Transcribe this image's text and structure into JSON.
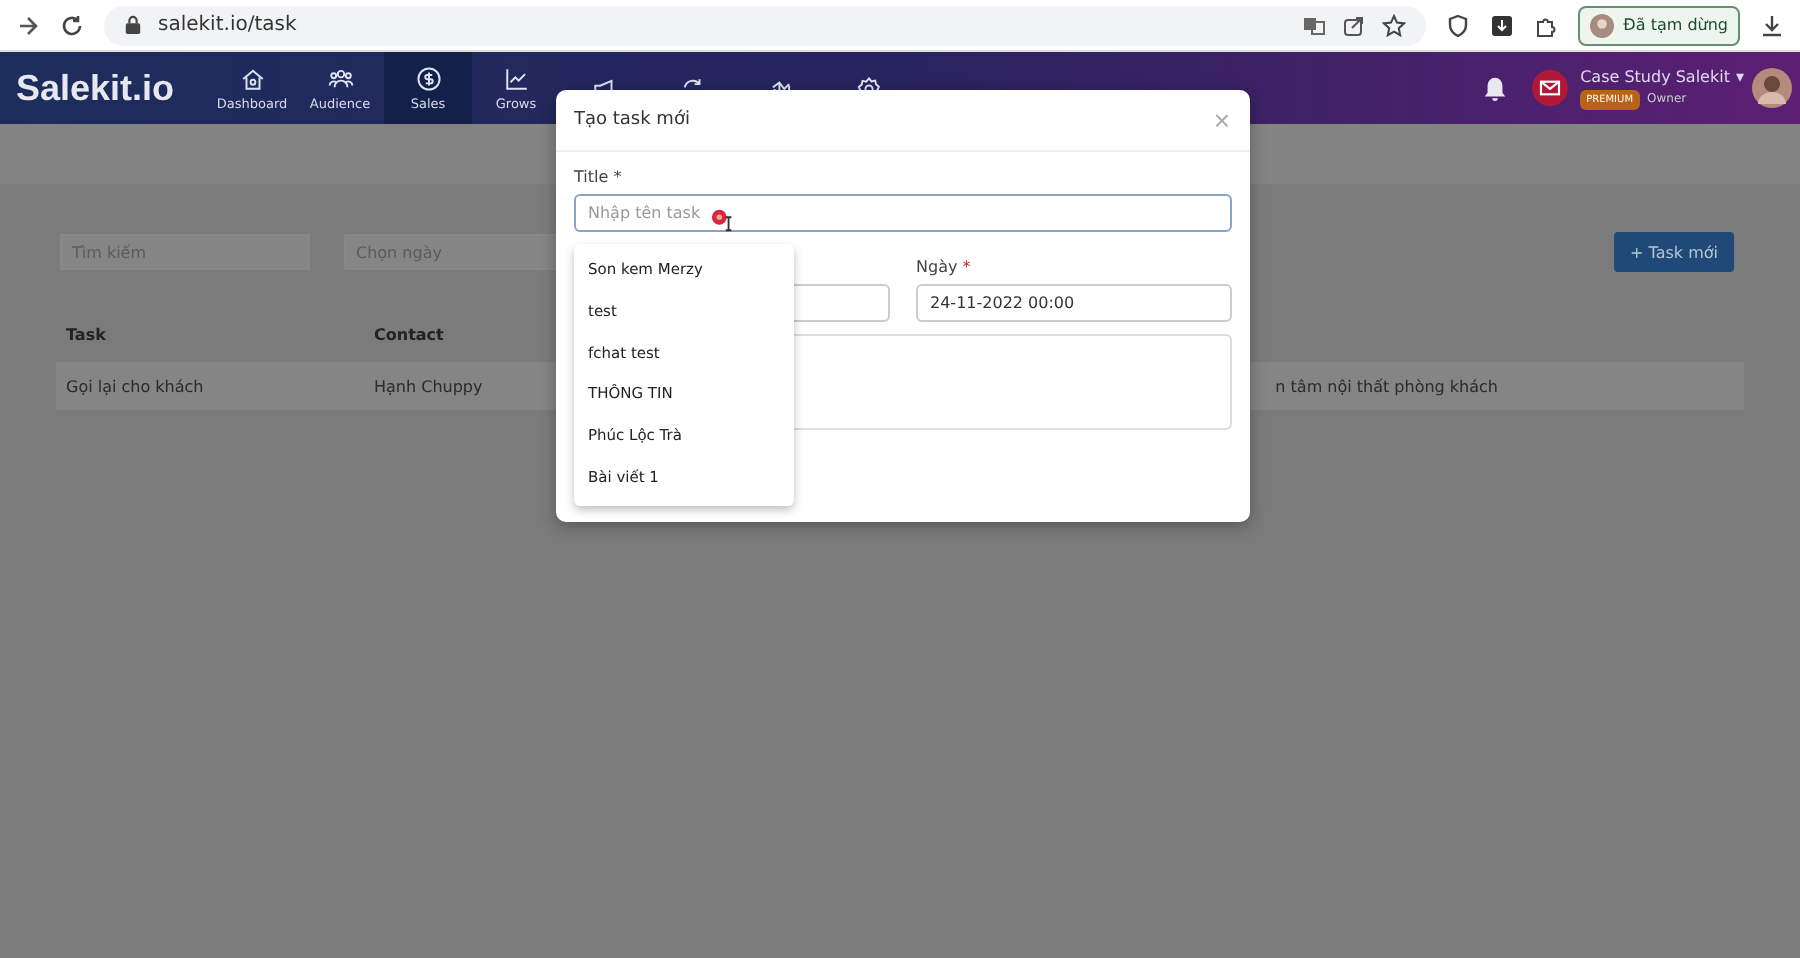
{
  "browser": {
    "url": "salekit.io/task",
    "profile_button": "Đã tạm dừng"
  },
  "nav": {
    "logo": "Salekit.io",
    "items": [
      {
        "label": "Dashboard",
        "kind": "home",
        "selected": false
      },
      {
        "label": "Audience",
        "kind": "people",
        "selected": false
      },
      {
        "label": "Sales",
        "kind": "dollar",
        "selected": true
      },
      {
        "label": "Grows",
        "kind": "trend",
        "selected": false
      },
      {
        "kind": "megaphone",
        "selected": false
      },
      {
        "kind": "sync",
        "selected": false
      },
      {
        "kind": "bars",
        "selected": false
      },
      {
        "kind": "gear",
        "selected": false
      }
    ],
    "account": {
      "name": "Case Study Salekit",
      "caret": "▾",
      "badge": "PREMIUM",
      "role": "Owner"
    }
  },
  "filters": {
    "search_placeholder": "Tìm kiếm",
    "date_placeholder": "Chọn ngày"
  },
  "new_task_button": "+ Task mới",
  "table": {
    "columns": [
      "Task",
      "Contact"
    ],
    "rows": [
      {
        "cells": [
          "Gọi lại cho khách",
          "Hạnh Chuppy"
        ],
        "column_last": "n tâm nội thất phòng khách"
      }
    ]
  },
  "modal": {
    "title": "Tạo task mới",
    "close": "×",
    "title_label": "Title",
    "title_required": "*",
    "title_placeholder": "Nhập tên task",
    "date_label": "Ngày",
    "date_required": "*",
    "date_value": "24-11-2022 00:00",
    "suggestions": [
      "Son kem Merzy",
      "test",
      "fchat test",
      "THÔNG TIN",
      "Phúc Lộc Trà",
      "Bài viết 1"
    ]
  }
}
